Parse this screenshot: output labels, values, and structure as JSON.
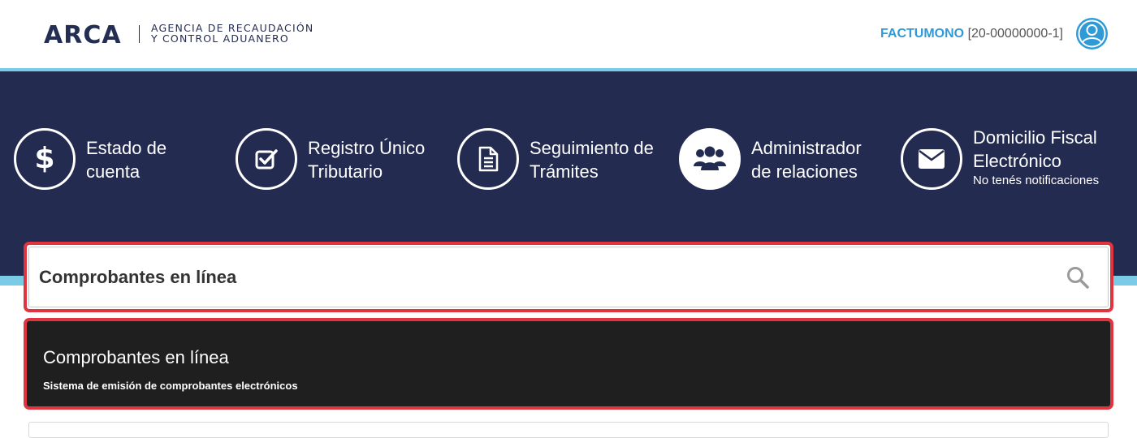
{
  "header": {
    "logo": "ARCA",
    "agency_line1": "AGENCIA DE RECAUDACIÓN",
    "agency_line2": "Y CONTROL ADUANERO",
    "user_name": "FACTUMONO",
    "user_cuit": "[20-00000000-1]",
    "avatar_icon": "user-avatar-icon"
  },
  "nav": {
    "items": [
      {
        "icon": "dollar-icon",
        "label1": "Estado de",
        "label2": "cuenta"
      },
      {
        "icon": "checkbox-icon",
        "label1": "Registro Único",
        "label2": "Tributario"
      },
      {
        "icon": "document-icon",
        "label1": "Seguimiento de",
        "label2": "Trámites"
      },
      {
        "icon": "users-icon",
        "label1": "Administrador",
        "label2": "de relaciones"
      },
      {
        "icon": "envelope-icon",
        "label1": "Domicilio Fiscal",
        "label2": "Electrónico",
        "sub": "No tenés notificaciones"
      }
    ]
  },
  "search": {
    "value": "Comprobantes en línea",
    "icon": "search-icon"
  },
  "result": {
    "title": "Comprobantes en línea",
    "subtitle": "Sistema de emisión de comprobantes electrónicos"
  },
  "colors": {
    "navy": "#242b51",
    "cyan": "#79cbe6",
    "accent_blue": "#2f9bd6",
    "highlight_red": "#e0343f",
    "result_bg": "#1f1f1f"
  }
}
